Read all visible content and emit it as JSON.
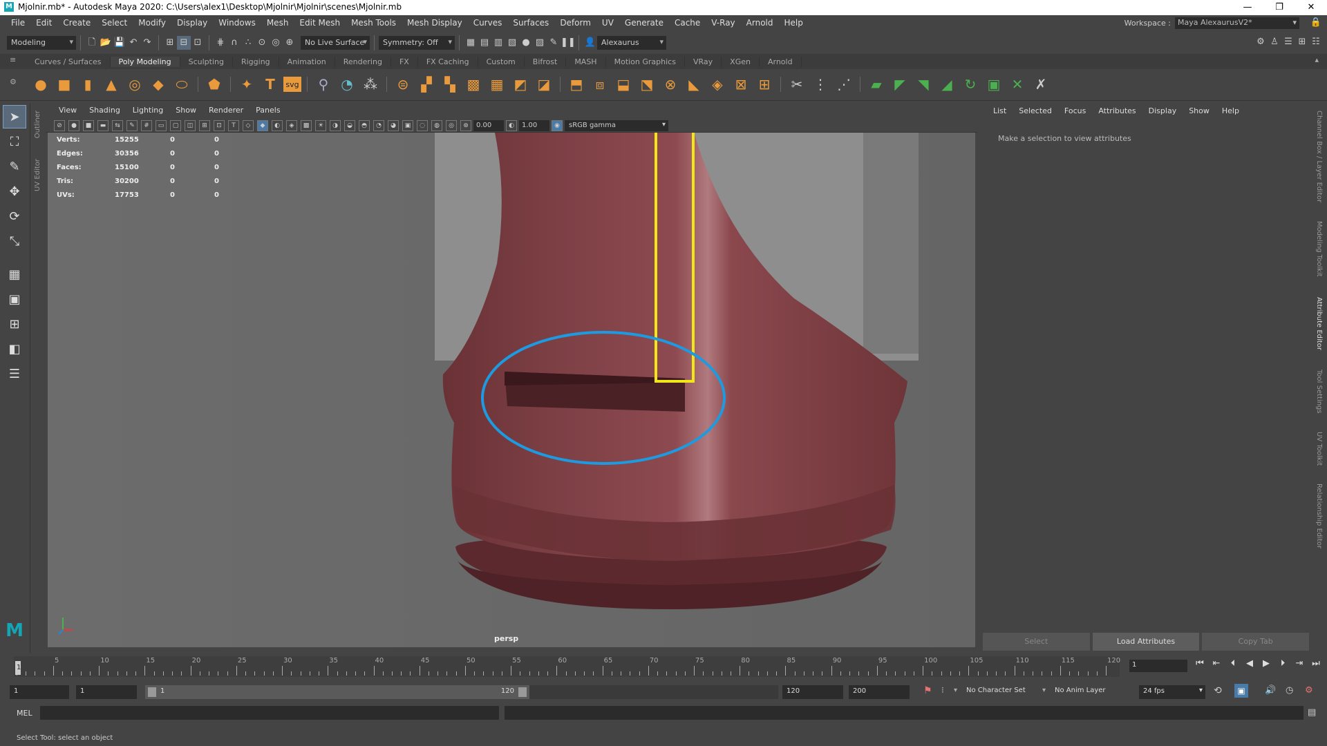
{
  "window": {
    "title": "Mjolnir.mb* - Autodesk Maya 2020: C:\\Users\\alex1\\Desktop\\Mjolnir\\Mjolnir\\scenes\\Mjolnir.mb",
    "logo_letter": "M"
  },
  "menubar": {
    "items": [
      "File",
      "Edit",
      "Create",
      "Select",
      "Modify",
      "Display",
      "Windows",
      "Mesh",
      "Edit Mesh",
      "Mesh Tools",
      "Mesh Display",
      "Curves",
      "Surfaces",
      "Deform",
      "UV",
      "Generate",
      "Cache",
      "V-Ray",
      "Arnold",
      "Help"
    ],
    "workspace_label": "Workspace :",
    "workspace_value": "Maya AlexaurusV2*"
  },
  "statusline": {
    "mode": "Modeling",
    "live_surface": "No Live Surface",
    "symmetry": "Symmetry: Off",
    "user": "Alexaurus"
  },
  "shelf": {
    "tabs": [
      "Curves / Surfaces",
      "Poly Modeling",
      "Sculpting",
      "Rigging",
      "Animation",
      "Rendering",
      "FX",
      "FX Caching",
      "Custom",
      "Bifrost",
      "MASH",
      "Motion Graphics",
      "VRay",
      "XGen",
      "Arnold"
    ],
    "active_tab": "Poly Modeling",
    "svg_label": "svg"
  },
  "left_vtabs": [
    "Outliner",
    "UV Editor"
  ],
  "viewport": {
    "menu": [
      "View",
      "Shading",
      "Lighting",
      "Show",
      "Renderer",
      "Panels"
    ],
    "exposure": "0.00",
    "gamma": "1.00",
    "colorspace": "sRGB gamma",
    "camera": "persp",
    "hud": [
      {
        "label": "Verts:",
        "a": "15255",
        "b": "0",
        "c": "0"
      },
      {
        "label": "Edges:",
        "a": "30356",
        "b": "0",
        "c": "0"
      },
      {
        "label": "Faces:",
        "a": "15100",
        "b": "0",
        "c": "0"
      },
      {
        "label": "Tris:",
        "a": "30200",
        "b": "0",
        "c": "0"
      },
      {
        "label": "UVs:",
        "a": "17753",
        "b": "0",
        "c": "0"
      }
    ],
    "colors": {
      "mesh": "#7a3f44",
      "highlight_box": "#f2e51a",
      "highlight_ellipse": "#1e9be0"
    }
  },
  "attribute_editor": {
    "menu": [
      "List",
      "Selected",
      "Focus",
      "Attributes",
      "Display",
      "Show",
      "Help"
    ],
    "message": "Make a selection to view attributes",
    "buttons": [
      "Select",
      "Load Attributes",
      "Copy Tab"
    ]
  },
  "right_vtabs": [
    "Channel Box / Layer Editor",
    "Modeling Toolkit",
    "Attribute Editor",
    "Tool Settings",
    "UV Toolkit",
    "Relationship Editor"
  ],
  "timeline": {
    "ticks": [
      "5",
      "10",
      "15",
      "20",
      "25",
      "30",
      "35",
      "40",
      "45",
      "50",
      "55",
      "60",
      "65",
      "70",
      "75",
      "80",
      "85",
      "90",
      "95",
      "100",
      "105",
      "110",
      "115",
      "120"
    ],
    "start_marker": "1",
    "current_frame": "1"
  },
  "range": {
    "start": "1",
    "playback_start": "1",
    "slider_start": "1",
    "slider_end": "120",
    "playback_end": "120",
    "end": "200",
    "character_set": "No Character Set",
    "anim_layer": "No Anim Layer",
    "fps": "24 fps"
  },
  "command_line": {
    "label": "MEL"
  },
  "help_line": {
    "text": "Select Tool: select an object"
  }
}
